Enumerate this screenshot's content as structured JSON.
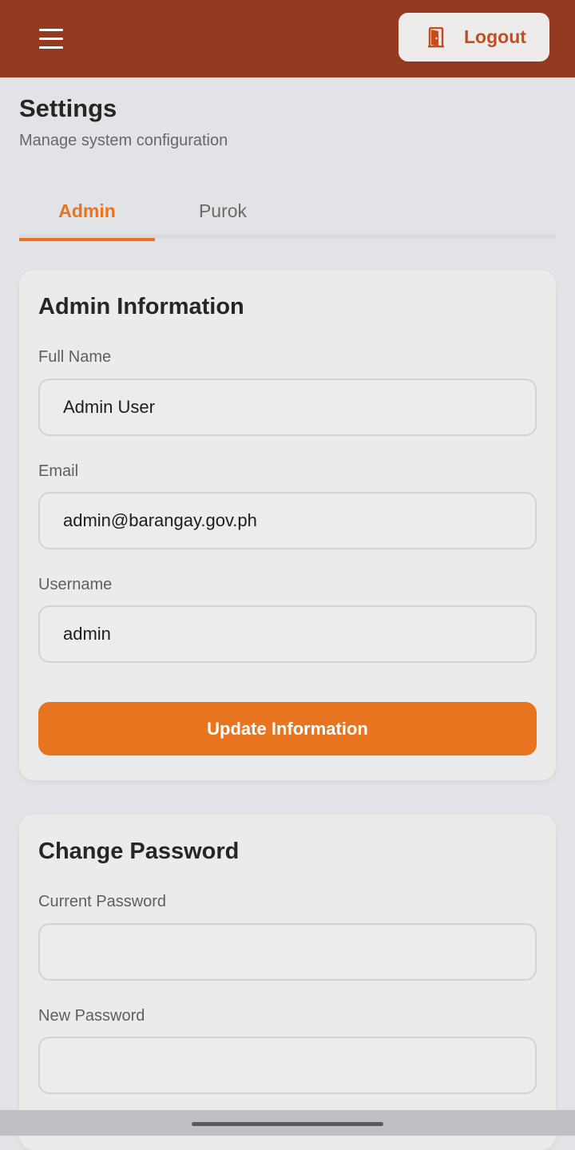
{
  "header": {
    "logout_label": "Logout",
    "colors": {
      "bar": "#943a20",
      "accent": "#e9731f"
    }
  },
  "page": {
    "title": "Settings",
    "subtitle": "Manage system configuration"
  },
  "tabs": [
    {
      "label": "Admin",
      "active": true
    },
    {
      "label": "Purok",
      "active": false
    }
  ],
  "admin_info": {
    "title": "Admin Information",
    "full_name_label": "Full Name",
    "full_name_value": "Admin User",
    "email_label": "Email",
    "email_value": "admin@barangay.gov.ph",
    "username_label": "Username",
    "username_value": "admin",
    "update_label": "Update Information"
  },
  "change_password": {
    "title": "Change Password",
    "current_label": "Current Password",
    "current_value": "",
    "new_label": "New Password",
    "new_value": ""
  },
  "icons": {
    "menu": "hamburger-icon",
    "logout": "door-icon"
  }
}
